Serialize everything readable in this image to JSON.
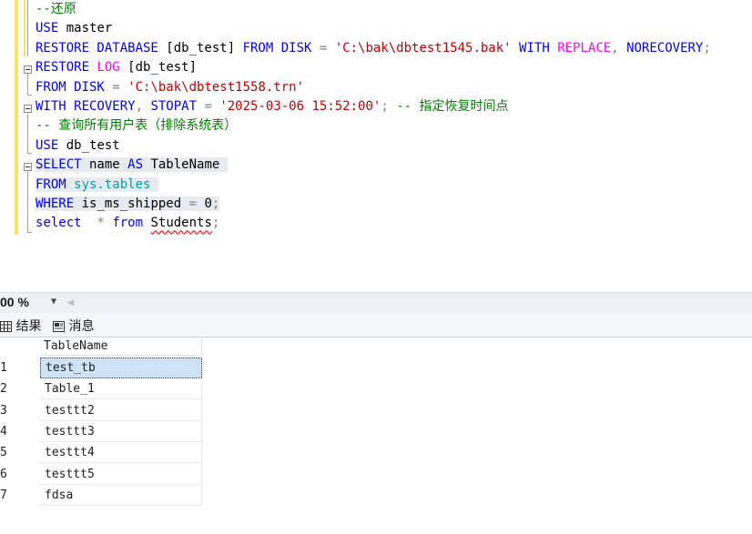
{
  "editor": {
    "lines": [
      {
        "parts": [
          {
            "t": "--还原",
            "c": "c"
          }
        ]
      },
      {
        "parts": [
          {
            "t": "USE",
            "c": "k"
          },
          {
            "t": " master",
            "c": ""
          }
        ]
      },
      {
        "parts": [
          {
            "t": "RESTORE DATABASE",
            "c": "k"
          },
          {
            "t": " [db_test] ",
            "c": ""
          },
          {
            "t": "FROM DISK",
            "c": "k"
          },
          {
            "t": " = ",
            "c": "g"
          },
          {
            "t": "'C:\\bak\\dbtest1545.bak'",
            "c": "s"
          },
          {
            "t": " ",
            "c": ""
          },
          {
            "t": "WITH",
            "c": "k"
          },
          {
            "t": " ",
            "c": ""
          },
          {
            "t": "REPLACE",
            "c": "f"
          },
          {
            "t": ", ",
            "c": "g"
          },
          {
            "t": "NORECOVERY",
            "c": "k"
          },
          {
            "t": ";",
            "c": "g"
          }
        ]
      },
      {
        "parts": [
          {
            "t": "RESTORE",
            "c": "k"
          },
          {
            "t": " ",
            "c": ""
          },
          {
            "t": "LOG",
            "c": "f"
          },
          {
            "t": " [db_test]",
            "c": ""
          }
        ]
      },
      {
        "parts": [
          {
            "t": "FROM DISK",
            "c": "k"
          },
          {
            "t": " = ",
            "c": "g"
          },
          {
            "t": "'C:\\bak\\dbtest1558.trn'",
            "c": "s"
          }
        ]
      },
      {
        "parts": [
          {
            "t": "WITH RECOVERY",
            "c": "k"
          },
          {
            "t": ", ",
            "c": "g"
          },
          {
            "t": "STOPAT",
            "c": "k"
          },
          {
            "t": " = ",
            "c": "g"
          },
          {
            "t": "'2025-03-06 15:52:00'",
            "c": "s"
          },
          {
            "t": "; ",
            "c": "g"
          },
          {
            "t": "-- 指定恢复时间点",
            "c": "c"
          }
        ]
      },
      {
        "parts": [
          {
            "t": "-- 查询所有用户表（排除系统表）",
            "c": "c"
          }
        ]
      },
      {
        "parts": [
          {
            "t": "USE",
            "c": "k"
          },
          {
            "t": " db_test",
            "c": ""
          }
        ]
      },
      {
        "sel": true,
        "parts": [
          {
            "t": "SELECT",
            "c": "k"
          },
          {
            "t": " name ",
            "c": ""
          },
          {
            "t": "AS",
            "c": "k"
          },
          {
            "t": " TableName ",
            "c": ""
          }
        ]
      },
      {
        "sel": true,
        "parts": [
          {
            "t": "FROM",
            "c": "k"
          },
          {
            "t": " ",
            "c": ""
          },
          {
            "t": "sys.tables",
            "c": "o"
          },
          {
            "t": " ",
            "c": ""
          }
        ]
      },
      {
        "sel": true,
        "parts": [
          {
            "t": "WHERE",
            "c": "k"
          },
          {
            "t": " is_ms_shipped ",
            "c": ""
          },
          {
            "t": "=",
            "c": "g"
          },
          {
            "t": " 0",
            "c": ""
          },
          {
            "t": ";",
            "c": "g"
          }
        ]
      },
      {
        "parts": [
          {
            "t": "select",
            "c": "k"
          },
          {
            "t": "  ",
            "c": ""
          },
          {
            "t": "*",
            "c": "g"
          },
          {
            "t": " ",
            "c": ""
          },
          {
            "t": "from",
            "c": "k"
          },
          {
            "t": " ",
            "c": ""
          },
          {
            "t": "Students",
            "c": "sq"
          },
          {
            "t": ";",
            "c": "g"
          }
        ]
      }
    ]
  },
  "zoom": {
    "value": "00 %"
  },
  "tabs": {
    "results": "结果",
    "messages": "消息"
  },
  "grid": {
    "header": "TableName",
    "rows": [
      {
        "n": "1",
        "v": "test_tb"
      },
      {
        "n": "2",
        "v": "Table_1"
      },
      {
        "n": "3",
        "v": "testtt2"
      },
      {
        "n": "4",
        "v": "testtt3"
      },
      {
        "n": "5",
        "v": "testtt4"
      },
      {
        "n": "6",
        "v": "testtt5"
      },
      {
        "n": "7",
        "v": "fdsa"
      }
    ]
  }
}
